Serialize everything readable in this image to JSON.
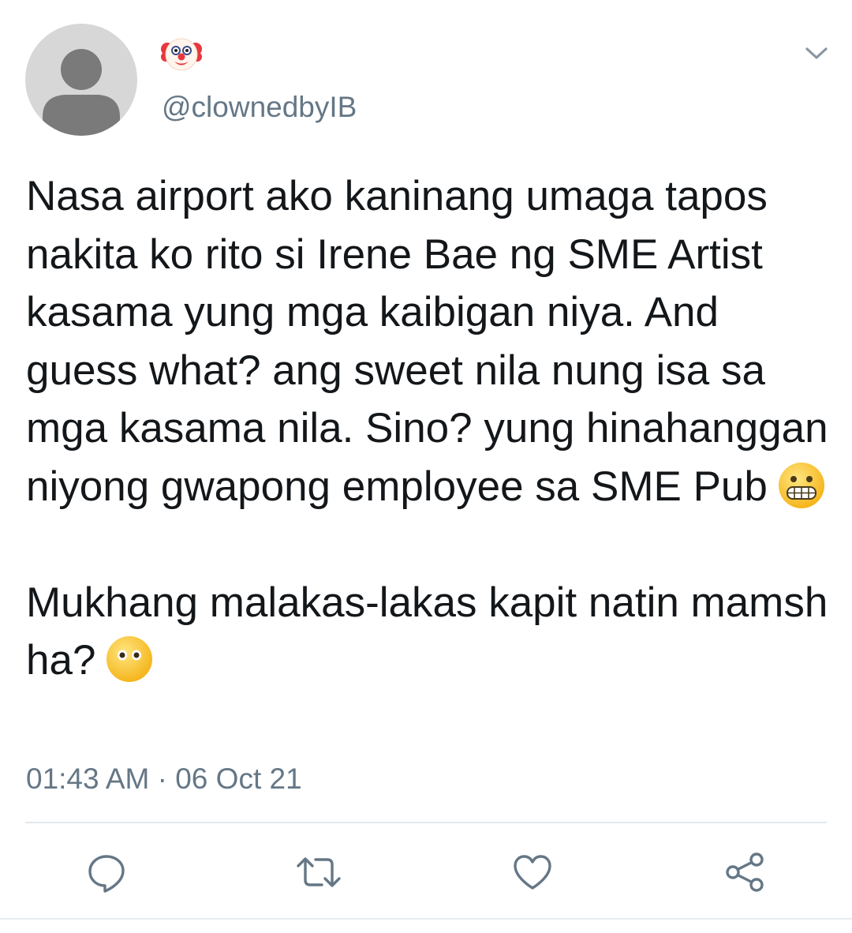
{
  "tweet": {
    "display_name_icon": "clown-face-emoji",
    "handle": "@clownedbyIB",
    "paragraphs": [
      {
        "text": "Nasa airport ako kaninang umaga tapos nakita ko rito si Irene Bae ng SME Artist kasama yung mga kaibigan niya. And guess what? ang sweet nila nung isa sa mga kasama nila. Sino? yung hinahanggan niyong gwapong employee sa SME Pub",
        "trailing_emoji": "grimacing-face-emoji"
      },
      {
        "text": "Mukhang malakas-lakas kapit natin mamsh ha?",
        "trailing_emoji": "face-without-mouth-emoji"
      }
    ],
    "time": "01:43 AM",
    "separator": "·",
    "date": "06 Oct 21"
  },
  "actions": {
    "reply_icon": "reply-icon",
    "retweet_icon": "retweet-icon",
    "like_icon": "heart-icon",
    "share_icon": "share-icon"
  },
  "colors": {
    "text": "#14171a",
    "secondary": "#657786",
    "avatar_bg": "#d7d7d7",
    "avatar_fg": "#7a7a7a",
    "divider": "#e1e8ed"
  }
}
